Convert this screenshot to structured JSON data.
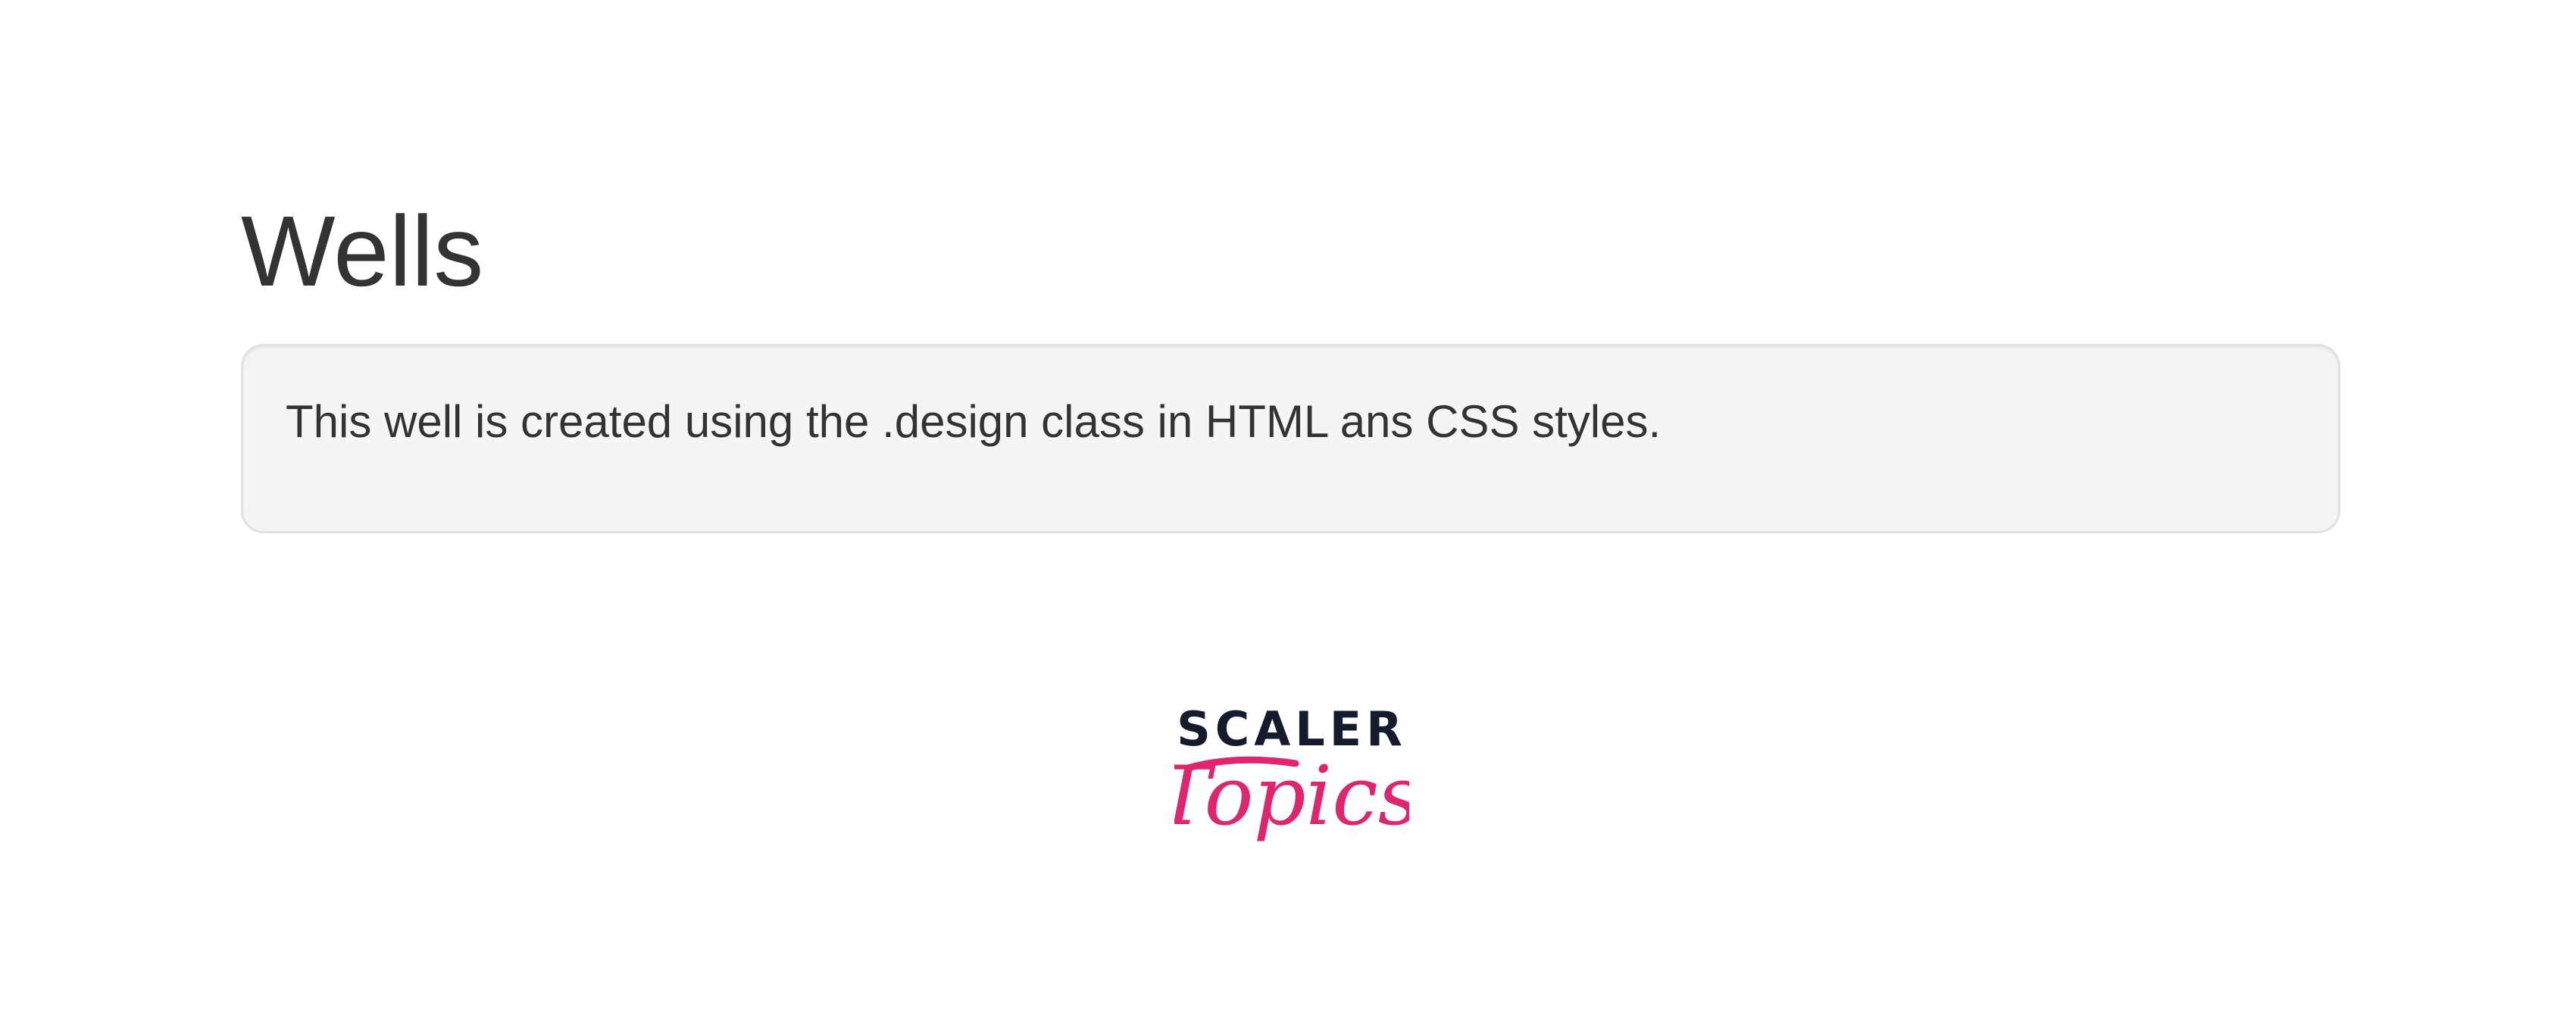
{
  "page": {
    "heading": "Wells",
    "well_text": "This well is created using the .design class in HTML ans CSS styles."
  },
  "logo": {
    "line1": "SCALER",
    "line2": "Topics",
    "line1_color": "#141b2d",
    "line2_color": "#e0256f"
  },
  "colors": {
    "text": "#333333",
    "well_background": "#f5f5f5",
    "well_border": "#e1e1e1",
    "page_background": "#ffffff"
  }
}
